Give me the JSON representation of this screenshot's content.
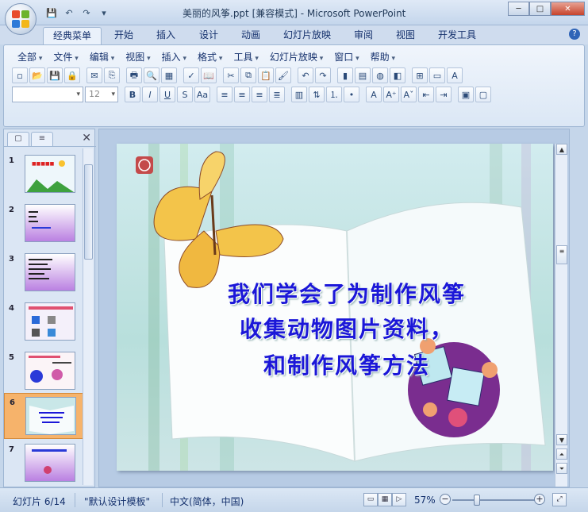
{
  "window": {
    "title": "美丽的风筝.ppt [兼容模式] - Microsoft PowerPoint",
    "minimize": "─",
    "maximize": "□",
    "close": "✕"
  },
  "ribbon_tabs": [
    "经典菜单",
    "开始",
    "插入",
    "设计",
    "动画",
    "幻灯片放映",
    "审阅",
    "视图",
    "开发工具"
  ],
  "help": "?",
  "menu": [
    "全部",
    "文件",
    "编辑",
    "视图",
    "插入",
    "格式",
    "工具",
    "幻灯片放映",
    "窗口",
    "帮助"
  ],
  "font_box": {
    "name": "",
    "size": "12"
  },
  "format_buttons": {
    "bold": "B",
    "italic": "I",
    "underline": "U",
    "strike": "S",
    "case": "Aa"
  },
  "panel": {
    "tab_slides": "▢",
    "tab_outline": "≡",
    "close": "✕",
    "thumbnails": [
      {
        "num": "1",
        "active": false
      },
      {
        "num": "2",
        "active": false
      },
      {
        "num": "3",
        "active": false
      },
      {
        "num": "4",
        "active": false
      },
      {
        "num": "5",
        "active": false
      },
      {
        "num": "6",
        "active": true
      },
      {
        "num": "7",
        "active": false
      }
    ]
  },
  "slide": {
    "line1": "我们学会了为制作风筝",
    "line2": "收集动物图片资料，",
    "line3": "和制作风筝方法"
  },
  "status": {
    "slide_pos": "幻灯片 6/14",
    "template": "\"默认设计模板\"",
    "language": "中文(简体，中国)",
    "zoom": "57%",
    "zoom_level": 0.3
  }
}
